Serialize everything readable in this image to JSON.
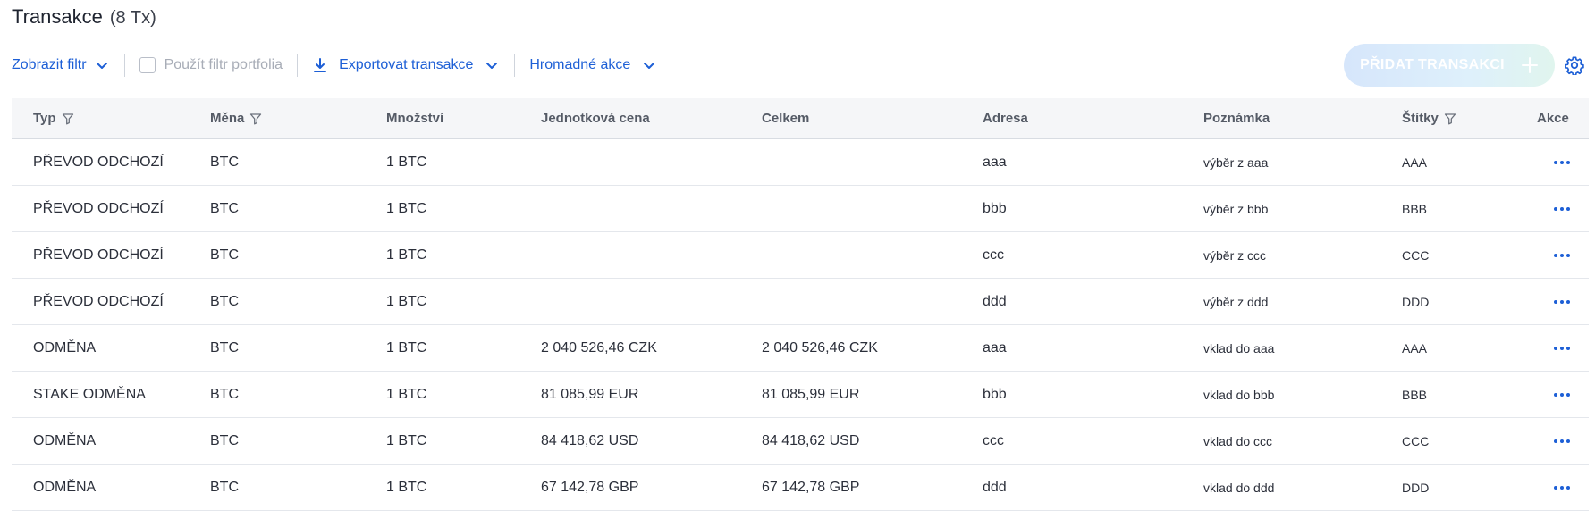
{
  "header": {
    "title": "Transakce",
    "count": "(8 Tx)"
  },
  "toolbar": {
    "show_filter": "Zobrazit filtr",
    "use_portfolio_filter": "Použít filtr portfolia",
    "export": "Exportovat transakce",
    "bulk_actions": "Hromadné akce",
    "add_transaction": "PŘIDAT TRANSAKCI"
  },
  "colors": {
    "accent": "#1d5fd6",
    "muted": "#a8adb7"
  },
  "table": {
    "columns": {
      "typ": "Typ",
      "mena": "Měna",
      "mnozstvi": "Množství",
      "jednotkova_cena": "Jednotková cena",
      "celkem": "Celkem",
      "adresa": "Adresa",
      "poznamka": "Poznámka",
      "stitky": "Štítky",
      "akce": "Akce"
    },
    "rows": [
      {
        "typ": "PŘEVOD ODCHOZÍ",
        "mena": "BTC",
        "mnozstvi": "1 BTC",
        "jc": "",
        "celkem": "",
        "adresa": "aaa",
        "poznamka": "výběr z aaa",
        "stitky": "AAA"
      },
      {
        "typ": "PŘEVOD ODCHOZÍ",
        "mena": "BTC",
        "mnozstvi": "1 BTC",
        "jc": "",
        "celkem": "",
        "adresa": "bbb",
        "poznamka": "výběr z bbb",
        "stitky": "BBB"
      },
      {
        "typ": "PŘEVOD ODCHOZÍ",
        "mena": "BTC",
        "mnozstvi": "1 BTC",
        "jc": "",
        "celkem": "",
        "adresa": "ccc",
        "poznamka": "výběr z ccc",
        "stitky": "CCC"
      },
      {
        "typ": "PŘEVOD ODCHOZÍ",
        "mena": "BTC",
        "mnozstvi": "1 BTC",
        "jc": "",
        "celkem": "",
        "adresa": "ddd",
        "poznamka": "výběr z ddd",
        "stitky": "DDD"
      },
      {
        "typ": "ODMĚNA",
        "mena": "BTC",
        "mnozstvi": "1 BTC",
        "jc": "2 040 526,46 CZK",
        "celkem": "2 040 526,46 CZK",
        "adresa": "aaa",
        "poznamka": "vklad do aaa",
        "stitky": "AAA"
      },
      {
        "typ": "STAKE ODMĚNA",
        "mena": "BTC",
        "mnozstvi": "1 BTC",
        "jc": "81 085,99 EUR",
        "celkem": "81 085,99 EUR",
        "adresa": "bbb",
        "poznamka": "vklad do bbb",
        "stitky": "BBB"
      },
      {
        "typ": "ODMĚNA",
        "mena": "BTC",
        "mnozstvi": "1 BTC",
        "jc": "84 418,62 USD",
        "celkem": "84 418,62 USD",
        "adresa": "ccc",
        "poznamka": "vklad do ccc",
        "stitky": "CCC"
      },
      {
        "typ": "ODMĚNA",
        "mena": "BTC",
        "mnozstvi": "1 BTC",
        "jc": "67 142,78 GBP",
        "celkem": "67 142,78 GBP",
        "adresa": "ddd",
        "poznamka": "vklad do ddd",
        "stitky": "DDD"
      }
    ]
  }
}
